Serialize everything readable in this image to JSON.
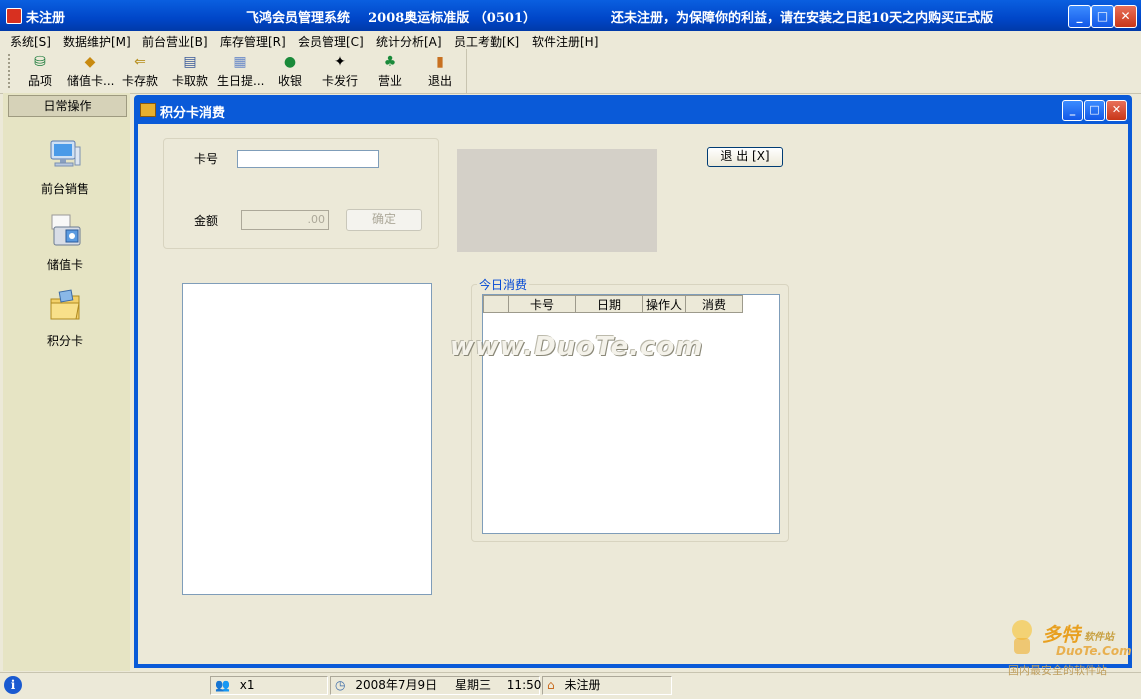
{
  "window": {
    "title": "未注册",
    "center_title": "飞鸿会员管理系统    2008奥运标准版 （0501）",
    "notice": "还未注册，为保障你的利益，请在安装之日起10天之内购买正式版"
  },
  "menu": [
    {
      "label": "系统[S]"
    },
    {
      "label": "数据维护[M]"
    },
    {
      "label": "前台营业[B]"
    },
    {
      "label": "库存管理[R]"
    },
    {
      "label": "会员管理[C]"
    },
    {
      "label": "统计分析[A]"
    },
    {
      "label": "员工考勤[K]"
    },
    {
      "label": "软件注册[H]"
    }
  ],
  "toolbar": [
    {
      "label": "品项",
      "icon": "database-icon"
    },
    {
      "label": "储值卡...",
      "icon": "box-icon"
    },
    {
      "label": "卡存款",
      "icon": "card-deposit-icon"
    },
    {
      "label": "卡取款",
      "icon": "card-withdraw-icon"
    },
    {
      "label": "生日提...",
      "icon": "birthday-icon"
    },
    {
      "label": "收银",
      "icon": "money-bag-icon"
    },
    {
      "label": "卡发行",
      "icon": "runner-icon"
    },
    {
      "label": "营业",
      "icon": "palm-tree-icon"
    },
    {
      "label": "退出",
      "icon": "exit-door-icon"
    }
  ],
  "sidebar": {
    "header": "日常操作",
    "items": [
      {
        "label": "前台销售",
        "icon": "computer-icon"
      },
      {
        "label": "储值卡",
        "icon": "card-reader-icon"
      },
      {
        "label": "积分卡",
        "icon": "folder-icon"
      }
    ]
  },
  "child_window": {
    "title": "积分卡消费",
    "card_label": "卡号",
    "card_value": "",
    "amount_label": "金额",
    "amount_value": ".00",
    "confirm_label": "确定",
    "exit_label": "退 出 [X]",
    "today_legend": "今日消费",
    "columns": [
      "",
      "卡号",
      "日期",
      "操作人",
      "消费"
    ]
  },
  "watermark": "www.DuoTe.com",
  "status": {
    "user": "x1",
    "date": "2008年7月9日",
    "weekday": "星期三",
    "time": "11:50",
    "reg": "未注册"
  },
  "corner_logo": {
    "brand": "多特",
    "brand_sub": "软件站",
    "url": "DuoTe.Com",
    "slogan": "国内最安全的软件站"
  },
  "colors": {
    "title_blue": "#0046c8",
    "window_bg": "#ece9d8",
    "legend_blue": "#0046d5"
  }
}
